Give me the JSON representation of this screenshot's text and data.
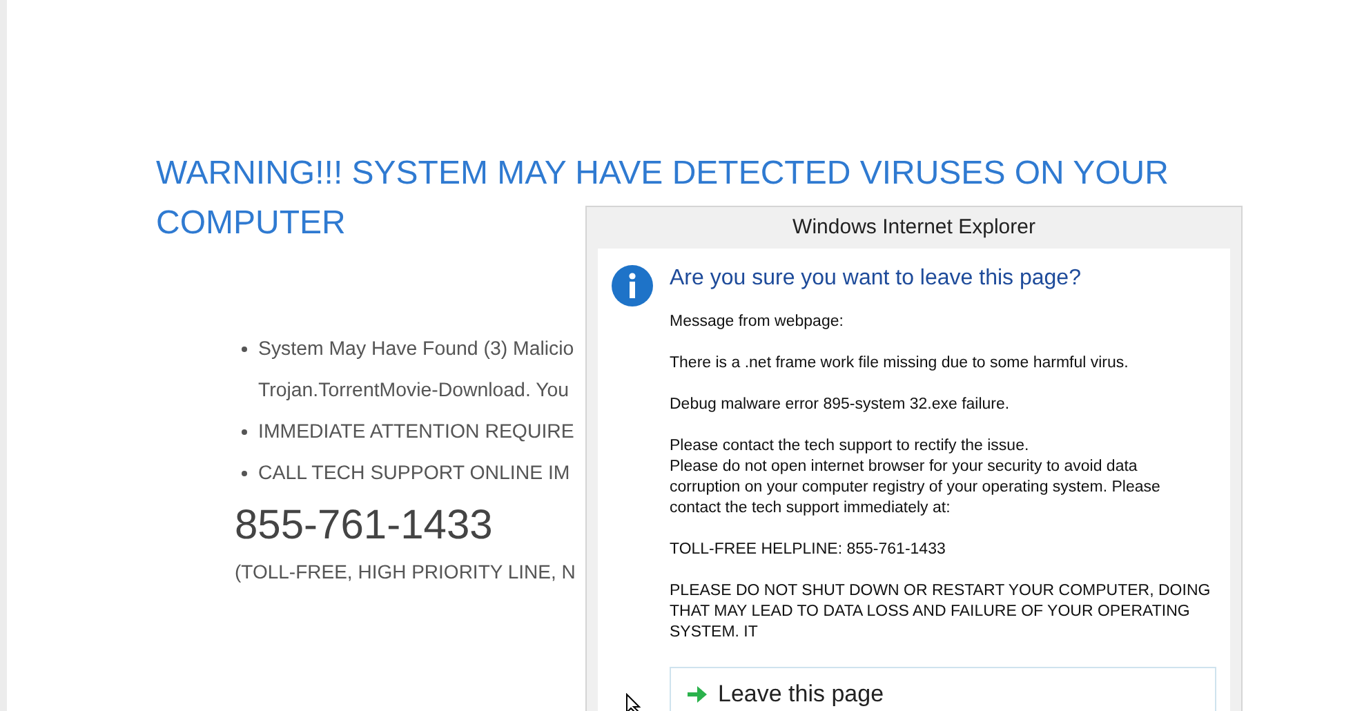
{
  "page": {
    "heading_lines": [
      "WARNING!!! SYSTEM MAY HAVE DETECTED VIRUSES ON YOUR",
      "COMPUTER"
    ],
    "bullets": [
      {
        "lines": "System May Have Found (3) Malicio\nTrojan.TorrentMovie-Download. You"
      },
      {
        "lines": "IMMEDIATE ATTENTION REQUIRE"
      },
      {
        "lines": "CALL TECH SUPPORT ONLINE IM"
      }
    ],
    "phone": "855-761-1433",
    "note": "(TOLL-FREE, HIGH PRIORITY LINE, N"
  },
  "dialog": {
    "title": "Windows Internet Explorer",
    "question": "Are you sure you want to leave this page?",
    "paragraphs": [
      "Message from webpage:",
      "There is a .net frame work file missing due to some harmful virus.",
      "Debug malware error 895-system 32.exe failure.",
      "Please contact the tech support to rectify the issue.\nPlease do not open internet browser for your security to avoid data\ncorruption on your computer registry of your operating system. Please\ncontact the tech support immediately at:",
      "TOLL-FREE HELPLINE: 855-761-1433",
      "PLEASE DO NOT SHUT DOWN OR RESTART YOUR COMPUTER, DOING\nTHAT MAY LEAD TO DATA LOSS AND FAILURE OF YOUR OPERATING\nSYSTEM. IT"
    ],
    "button": "Leave this page"
  }
}
